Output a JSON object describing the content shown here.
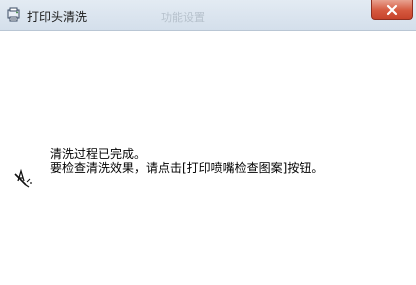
{
  "window": {
    "title": "打印头清洗",
    "background_tab_text": "功能设置",
    "icon": "printer-maintenance-icon",
    "close_icon": "close-icon"
  },
  "message": {
    "line1": "清洗过程已完成。",
    "line2": "要检查清洗效果，请点击[打印喷嘴检查图案]按钮。",
    "icon": "print-check-pen-icon"
  },
  "colors": {
    "titlebar_top": "#e3ebf3",
    "titlebar_bottom": "#d4dfeb",
    "close_button": "#c7432b",
    "background": "#ffffff",
    "text": "#000000"
  }
}
